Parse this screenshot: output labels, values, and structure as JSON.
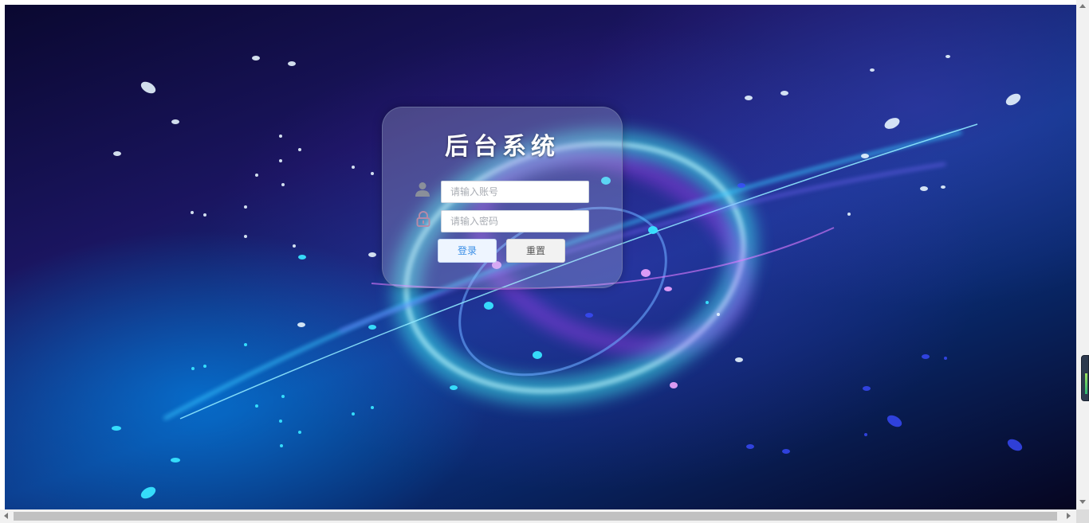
{
  "login": {
    "title": "后台系统",
    "account": {
      "placeholder": "请输入账号",
      "value": "",
      "icon": "user-icon"
    },
    "password": {
      "placeholder": "请输入密码",
      "value": "",
      "icon": "lock-icon"
    },
    "login_button": "登录",
    "reset_button": "重置"
  },
  "colors": {
    "login_button_text": "#3a8ee6",
    "panel_background": "rgba(190,200,230,0.28)",
    "title_text": "#ffffff"
  }
}
